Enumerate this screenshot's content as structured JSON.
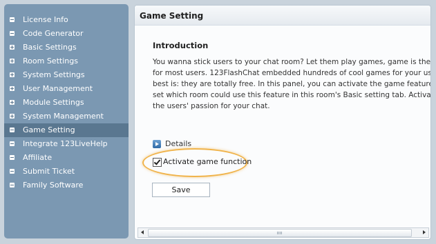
{
  "sidebar": {
    "items": [
      {
        "label": "License Info",
        "icon": "minus-icon"
      },
      {
        "label": "Code Generator",
        "icon": "minus-icon"
      },
      {
        "label": "Basic Settings",
        "icon": "plus-icon"
      },
      {
        "label": "Room Settings",
        "icon": "plus-icon"
      },
      {
        "label": "System Settings",
        "icon": "plus-icon"
      },
      {
        "label": "User Management",
        "icon": "plus-icon"
      },
      {
        "label": "Module Settings",
        "icon": "plus-icon"
      },
      {
        "label": "System Management",
        "icon": "plus-icon"
      },
      {
        "label": "Game Setting",
        "icon": "minus-icon",
        "active": true
      },
      {
        "label": "Integrate 123LiveHelp",
        "icon": "minus-icon"
      },
      {
        "label": "Affiliate",
        "icon": "minus-icon"
      },
      {
        "label": "Submit Ticket",
        "icon": "minus-icon"
      },
      {
        "label": "Family Software",
        "icon": "minus-icon"
      }
    ]
  },
  "panel": {
    "title": "Game Setting",
    "section_title": "Introduction",
    "intro_lines": [
      "You wanna stick users to your chat room? Let them play games, game is the most fa",
      "for most users. 123FlashChat embedded hundreds of cool games for your users' che",
      "best is: they are totally free. In this panel, you can activate the game feature, and",
      "set which room could use this feature in this room's Basic setting tab. Activate game",
      "the users' passion for your chat."
    ],
    "details_label": "Details",
    "checkbox_label": "Activate game function",
    "checkbox_checked": true,
    "save_label": "Save"
  },
  "colors": {
    "sidebar_bg": "#7b98b2",
    "sidebar_active": "#5a7790",
    "highlight_ring": "#f0b34a"
  }
}
